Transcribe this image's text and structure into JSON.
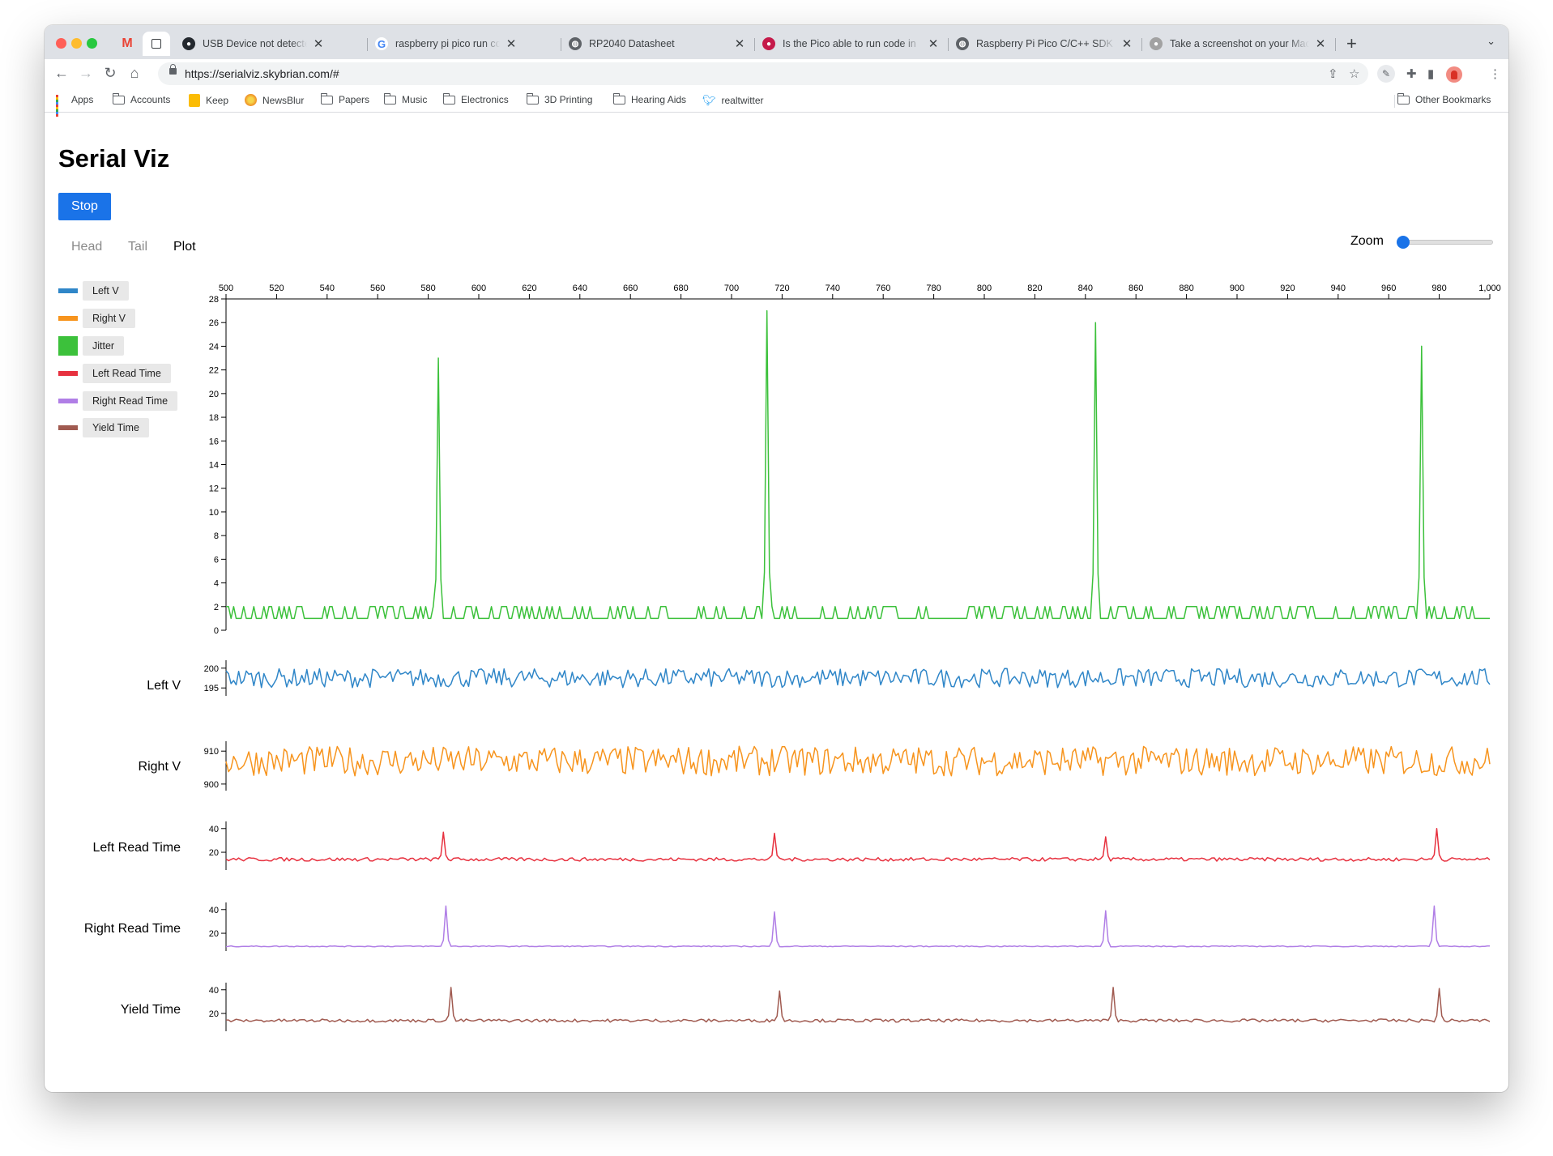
{
  "browser": {
    "tabs": [
      {
        "title": "USB Device not detected by hos",
        "favicon": "github-icon"
      },
      {
        "title": "raspberry pi pico run code in m",
        "favicon": "google-icon"
      },
      {
        "title": "RP2040 Datasheet",
        "favicon": "globe-icon"
      },
      {
        "title": "Is the Pico able to run code in",
        "favicon": "raspberry-pi-icon"
      },
      {
        "title": "Raspberry Pi Pico C/C++ SDK",
        "favicon": "globe-icon"
      },
      {
        "title": "Take a screenshot on your Mac",
        "favicon": "apple-icon"
      }
    ],
    "url": "https://serialviz.skybrian.com/#",
    "bookmarks": [
      {
        "label": "Apps",
        "icon": "apps-grid-icon"
      },
      {
        "label": "Accounts",
        "icon": "folder-icon"
      },
      {
        "label": "Keep",
        "icon": "keep-icon"
      },
      {
        "label": "NewsBlur",
        "icon": "newsblur-icon"
      },
      {
        "label": "Papers",
        "icon": "folder-icon"
      },
      {
        "label": "Music",
        "icon": "folder-icon"
      },
      {
        "label": "Electronics",
        "icon": "folder-icon"
      },
      {
        "label": "3D Printing",
        "icon": "folder-icon"
      },
      {
        "label": "Hearing Aids",
        "icon": "folder-icon"
      },
      {
        "label": "realtwitter",
        "icon": "twitter-icon"
      }
    ],
    "other_bookmarks": "Other Bookmarks"
  },
  "page": {
    "title": "Serial Viz",
    "stop_label": "Stop",
    "tabs": [
      "Head",
      "Tail",
      "Plot"
    ],
    "active_tab": "Plot",
    "zoom_label": "Zoom",
    "zoom_value": 0
  },
  "legend": [
    {
      "label": "Left V",
      "color": "#2f86c8"
    },
    {
      "label": "Right V",
      "color": "#f7941d"
    },
    {
      "label": "Jitter",
      "color": "#3cc13b"
    },
    {
      "label": "Left Read Time",
      "color": "#e7313f"
    },
    {
      "label": "Right Read Time",
      "color": "#b07ee6"
    },
    {
      "label": "Yield Time",
      "color": "#a05a50"
    }
  ],
  "chart_data": [
    {
      "type": "line",
      "title": "Jitter",
      "x_range": [
        500,
        1000
      ],
      "x_ticks": [
        500,
        520,
        540,
        560,
        580,
        600,
        620,
        640,
        660,
        680,
        700,
        720,
        740,
        760,
        780,
        800,
        820,
        840,
        860,
        880,
        900,
        920,
        940,
        960,
        980,
        1000
      ],
      "x_tick_labels": [
        "500",
        "520",
        "540",
        "560",
        "580",
        "600",
        "620",
        "640",
        "660",
        "680",
        "700",
        "720",
        "740",
        "760",
        "780",
        "800",
        "820",
        "840",
        "860",
        "880",
        "900",
        "920",
        "940",
        "960",
        "980",
        "1,000"
      ],
      "ylim": [
        0,
        28
      ],
      "y_ticks": [
        0,
        2,
        4,
        6,
        8,
        10,
        12,
        14,
        16,
        18,
        20,
        22,
        24,
        26,
        28
      ],
      "baseline": 1,
      "noise_high": 2,
      "spikes": [
        {
          "x": 584,
          "y": 23
        },
        {
          "x": 714,
          "y": 27
        },
        {
          "x": 844,
          "y": 26
        },
        {
          "x": 973,
          "y": 24
        }
      ],
      "series": [
        {
          "name": "Jitter",
          "color": "#3cc13b"
        }
      ]
    },
    {
      "type": "line",
      "label": "Left V",
      "ylim": [
        193,
        202
      ],
      "y_ticks": [
        195,
        200
      ],
      "baseline": 197.5,
      "amplitude": 2.4,
      "series": [
        {
          "name": "Left V",
          "color": "#2f86c8"
        }
      ]
    },
    {
      "type": "line",
      "label": "Right V",
      "ylim": [
        898,
        913
      ],
      "y_ticks": [
        900,
        910
      ],
      "baseline": 907,
      "amplitude": 4.5,
      "series": [
        {
          "name": "Right V",
          "color": "#f7941d"
        }
      ]
    },
    {
      "type": "line",
      "label": "Left Read Time",
      "ylim": [
        5,
        46
      ],
      "y_ticks": [
        20,
        40
      ],
      "baseline": 14,
      "amplitude": 1.5,
      "spikes": [
        {
          "x": 586,
          "y": 37
        },
        {
          "x": 717,
          "y": 36
        },
        {
          "x": 848,
          "y": 33
        },
        {
          "x": 979,
          "y": 40
        }
      ],
      "series": [
        {
          "name": "Left Read Time",
          "color": "#e7313f"
        }
      ]
    },
    {
      "type": "line",
      "label": "Right Read Time",
      "ylim": [
        5,
        46
      ],
      "y_ticks": [
        20,
        40
      ],
      "baseline": 9,
      "amplitude": 0.4,
      "spikes": [
        {
          "x": 587,
          "y": 43
        },
        {
          "x": 717,
          "y": 38
        },
        {
          "x": 848,
          "y": 39
        },
        {
          "x": 978,
          "y": 43
        }
      ],
      "series": [
        {
          "name": "Right Read Time",
          "color": "#b07ee6"
        }
      ]
    },
    {
      "type": "line",
      "label": "Yield Time",
      "ylim": [
        5,
        46
      ],
      "y_ticks": [
        20,
        40
      ],
      "baseline": 14,
      "amplitude": 1.3,
      "spikes": [
        {
          "x": 589,
          "y": 42
        },
        {
          "x": 719,
          "y": 39
        },
        {
          "x": 851,
          "y": 42
        },
        {
          "x": 980,
          "y": 41
        }
      ],
      "series": [
        {
          "name": "Yield Time",
          "color": "#a05a50"
        }
      ]
    }
  ]
}
